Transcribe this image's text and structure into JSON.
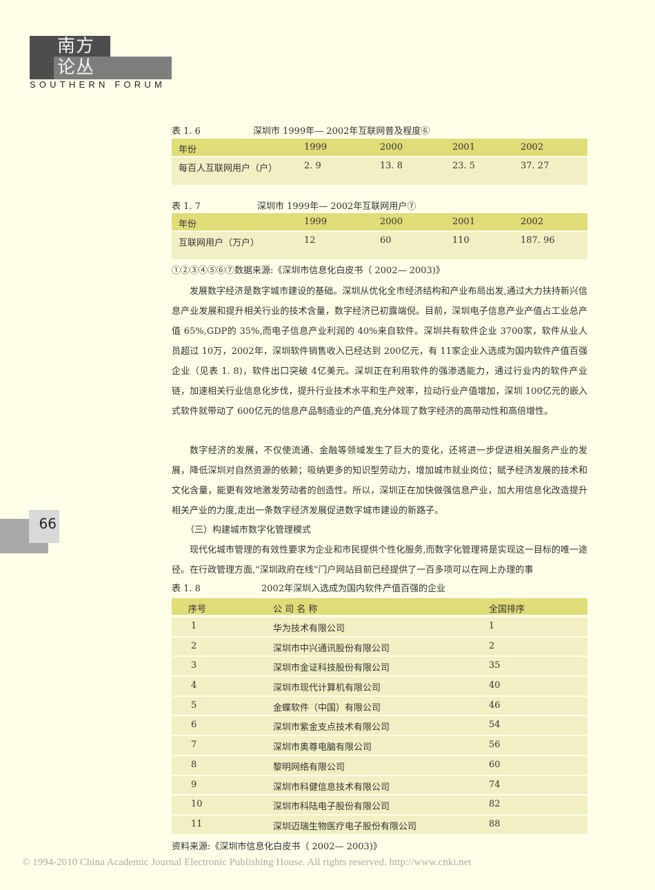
{
  "header": {
    "logo_cn_1": "南方",
    "logo_cn_2": "论丛",
    "logo_en": "SOUTHERN FORUM"
  },
  "page_number": "66",
  "table_1_6": {
    "label": "表 1. 6",
    "title": "深圳市 1999年— 2002年互联网普及程度⑥",
    "headers": [
      "年份",
      "1999",
      "2000",
      "2001",
      "2002"
    ],
    "row": [
      "每百人互联网用户（户）",
      "2. 9",
      "13. 8",
      "23. 5",
      "37. 27"
    ]
  },
  "table_1_7": {
    "label": "表 1. 7",
    "title": "深圳市 1999年— 2002年互联网用户⑦",
    "headers": [
      "年份",
      "1999",
      "2000",
      "2001",
      "2002"
    ],
    "row": [
      "互联网用户（万户）",
      "12",
      "60",
      "110",
      "187. 96"
    ]
  },
  "footnote": "①②③④⑤⑥⑦数据来源:《深圳市信息化白皮书（ 2002— 2003)》",
  "paragraphs": [
    "发展数字经济是数字城市建设的基础。深圳从优化全市经济结构和产业布局出发,通过大力扶持新兴信息产业发展和提升相关行业的技术含量，数字经济已初露端倪。目前，深圳电子信息产业产值占工业总产值 65%,GDP的 35%,而电子信息产业利润的 40%来自软件。深圳共有软件企业 3700家，软件从业人员超过 10万，2002年，深圳软件销售收入已经达到 200亿元，有 11家企业入选成为国内软件产值百强企业（见表 1. 8)，软件出口突破 4亿美元。深圳正在利用软件的强渗透能力，通过行业内的软件产业链，加速相关行业信息化步伐，提升行业技术水平和生产效率，拉动行业产值增加，深圳 100亿元的嵌入式软件就带动了 600亿元的信息产品制造业的产值,充分体现了数字经济的高带动性和高倍增性。",
    "数字经济的发展，不仅使流通、金融等领域发生了巨大的变化，还将进一步促进相关服务产业的发展，降低深圳对自然资源的依赖；吸纳更多的知识型劳动力，增加城市就业岗位；赋予经济发展的技术和文化含量，能更有效地激发劳动者的创造性。所以，深圳正在加快做强信息产业，加大用信息化改造提升相关产业的力度,走出一条数字经济发展促进数字城市建设的新路子。",
    "（三）构建城市数字化管理模式",
    "现代化城市管理的有效性要求为企业和市民提供个性化服务,而数字化管理将是实现这一目标的唯一途径。在行政管理方面,“深圳政府在线”门户网站目前已经提供了一百多项可以在网上办理的事"
  ],
  "table_1_8": {
    "label": "表 1. 8",
    "title": "2002年深圳入选成为国内软件产值百强的企业",
    "headers": [
      "序号",
      "公 司 名 称",
      "全国排序"
    ],
    "rows": [
      [
        "1",
        "华为技术有限公司",
        "1"
      ],
      [
        "2",
        "深圳市中兴通讯股份有限公司",
        "2"
      ],
      [
        "3",
        "深圳市金证科技股份有限公司",
        "35"
      ],
      [
        "4",
        "深圳市现代计算机有限公司",
        "40"
      ],
      [
        "5",
        "金蝶软件（中国）有限公司",
        "46"
      ],
      [
        "6",
        "深圳市紫金支点技术有限公司",
        "54"
      ],
      [
        "7",
        "深圳市奥尊电脑有限公司",
        "56"
      ],
      [
        "8",
        "黎明网络有限公司",
        "60"
      ],
      [
        "9",
        "深圳市科健信息技术有限公司",
        "74"
      ],
      [
        "10",
        "深圳市科陆电子股份有限公司",
        "82"
      ],
      [
        "11",
        "深圳迈瑞生物医疗电子股份有限公司",
        "88"
      ]
    ],
    "source": "资料来源:《深圳市信息化白皮书（ 2002— 2003)》"
  },
  "copyright": "© 1994-2010 China Academic Journal Electronic Publishing House. All rights reserved.    http://www.cnki.net"
}
